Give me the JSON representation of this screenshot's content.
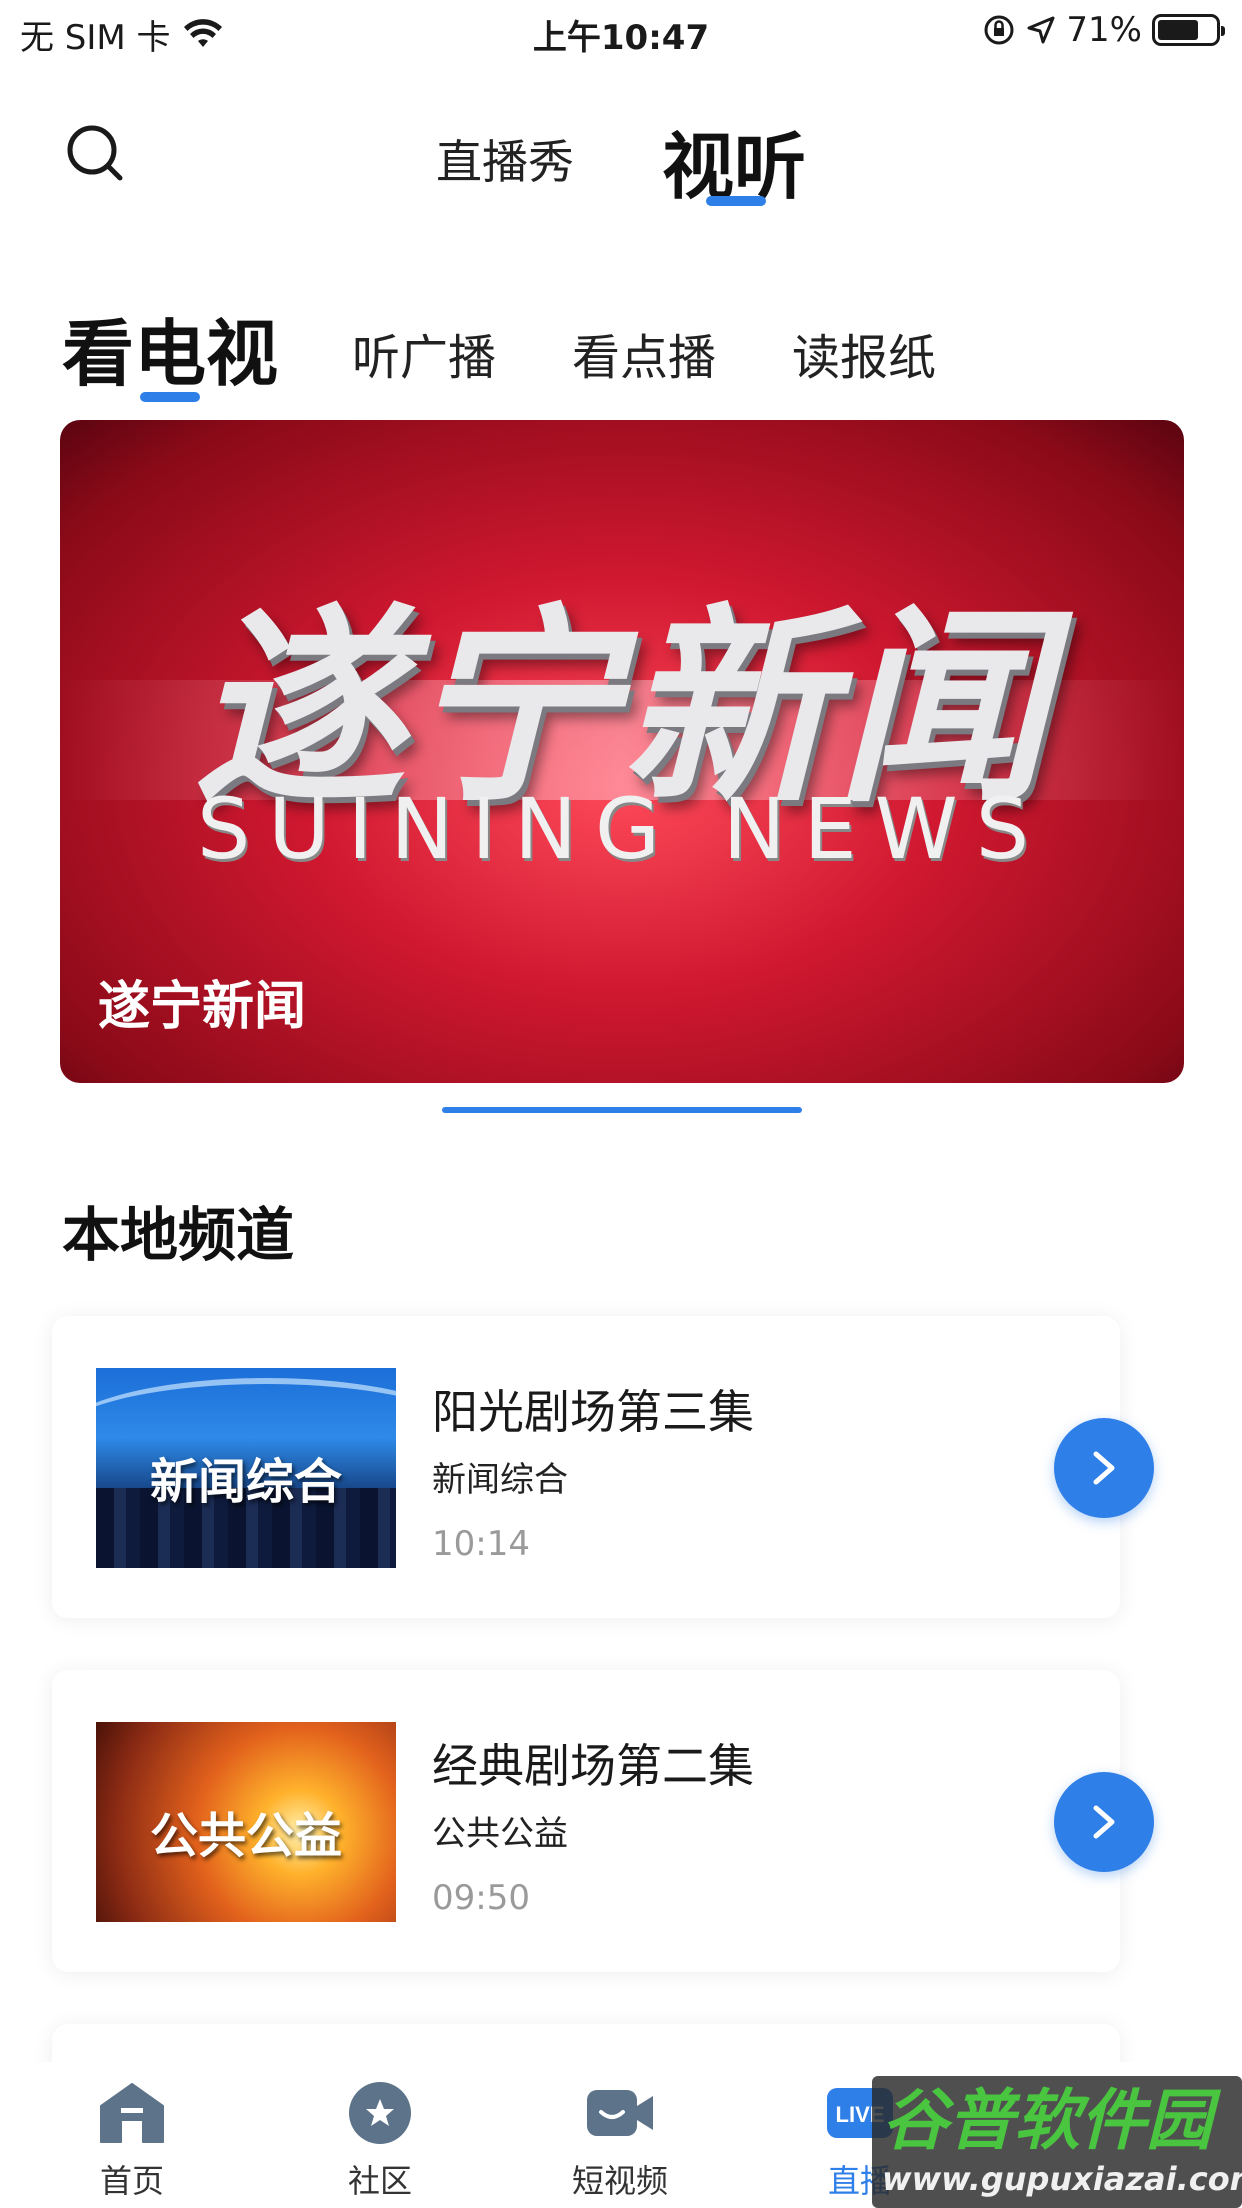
{
  "status_bar": {
    "carrier": "无 SIM 卡",
    "time": "上午10:47",
    "battery": "71%"
  },
  "top_nav": {
    "tabs": [
      {
        "label": "直播秀"
      },
      {
        "label": "视听"
      }
    ],
    "active_tab": "视听"
  },
  "category_tabs": [
    {
      "label": "看电视"
    },
    {
      "label": "听广播"
    },
    {
      "label": "看点播"
    },
    {
      "label": "读报纸"
    }
  ],
  "banner": {
    "logo_text": "遂宁新闻",
    "logo_subtitle": "SUINING NEWS",
    "caption": "遂宁新闻"
  },
  "section": {
    "title": "本地频道"
  },
  "channels": [
    {
      "thumb_text": "新闻综合",
      "program": "阳光剧场第三集",
      "channel": "新闻综合",
      "time": "10:14"
    },
    {
      "thumb_text": "公共公益",
      "program": "经典剧场第二集",
      "channel": "公共公益",
      "time": "09:50"
    }
  ],
  "tab_bar": {
    "items": [
      {
        "label": "首页",
        "icon": "home-icon"
      },
      {
        "label": "社区",
        "icon": "star-icon"
      },
      {
        "label": "短视频",
        "icon": "video-icon"
      },
      {
        "label": "直播",
        "icon": "live-icon"
      }
    ]
  },
  "watermark": {
    "main": "谷普软件园",
    "url": "www.gupuxiazai.com"
  },
  "colors": {
    "accent": "#2f7fe8",
    "banner_red": "#d01830"
  }
}
